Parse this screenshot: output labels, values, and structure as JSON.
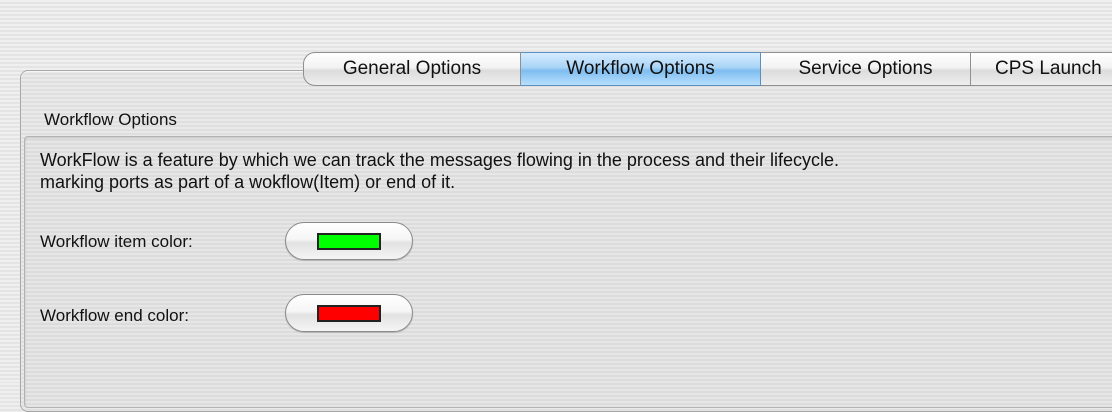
{
  "tabs": [
    {
      "label": "General Options",
      "active": false
    },
    {
      "label": "Workflow Options",
      "active": true
    },
    {
      "label": "Service Options",
      "active": false
    },
    {
      "label": "CPS Launch",
      "active": false
    }
  ],
  "group": {
    "title": "Workflow Options",
    "description_line1": "WorkFlow is a feature by which we can track the messages flowing in the process and their lifecycle.",
    "description_line2": "marking ports as part of a wokflow(Item) or end of it."
  },
  "fields": {
    "item_label": "Workflow item color:",
    "item_color": "#00ff00",
    "end_label": "Workflow end color:",
    "end_color": "#ff0000"
  },
  "colors": {
    "active_tab": "#8fc6f1",
    "panel_background": "#e5e5e5"
  }
}
